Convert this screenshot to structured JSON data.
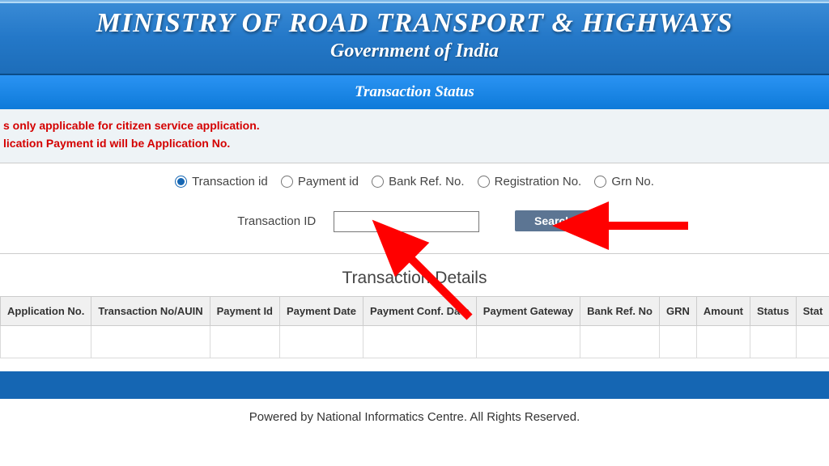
{
  "header": {
    "title": "MINISTRY OF ROAD TRANSPORT & HIGHWAYS",
    "subtitle": "Government of India"
  },
  "page_title": "Transaction Status",
  "notices": {
    "line1": "s only applicable for citizen service application.",
    "line2": "lication Payment id will be Application No."
  },
  "search": {
    "radios": {
      "transaction_id": "Transaction id",
      "payment_id": "Payment id",
      "bank_ref_no": "Bank Ref. No.",
      "registration_no": "Registration No.",
      "grn_no": "Grn No."
    },
    "input_label": "Transaction ID",
    "button": "Search"
  },
  "table": {
    "heading": "Transaction Details",
    "columns": [
      "Application No.",
      "Transaction No/AUIN",
      "Payment Id",
      "Payment Date",
      "Payment Conf. Date",
      "Payment Gateway",
      "Bank Ref. No",
      "GRN",
      "Amount",
      "Status",
      "Stat"
    ]
  },
  "footer": "Powered by National Informatics Centre. All Rights Reserved."
}
